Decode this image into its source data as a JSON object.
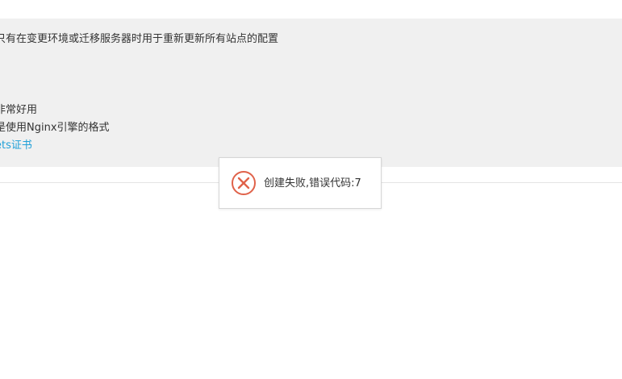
{
  "info_panel": {
    "line1": "只有在变更环境或迁移服务器时用于重新更新所有站点的配置",
    "line2": "非常好用",
    "line3": "是使用Nginx引擎的格式",
    "line4_link": "ets证书"
  },
  "toast": {
    "icon": "error-icon",
    "message": "创建失败,错误代码:7",
    "color": "#e0624a"
  }
}
